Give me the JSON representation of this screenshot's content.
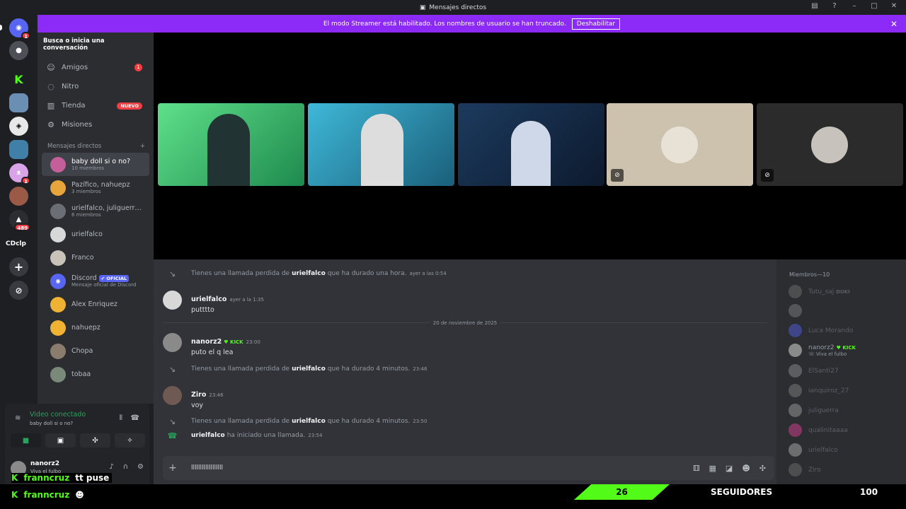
{
  "window": {
    "title": "Mensajes directos"
  },
  "banner": {
    "text": "El modo Streamer está habilitado. Los nombres de usuario se han truncado.",
    "button": "Deshabilitar"
  },
  "servers": {
    "badge_top": "1",
    "badge_cat": "1",
    "badge_489": "489",
    "text_server": "CDclp"
  },
  "sidebar": {
    "search": "Busca o inicia una conversación",
    "nav": [
      {
        "label": "Amigos",
        "badge": "1"
      },
      {
        "label": "Nitro"
      },
      {
        "label": "Tienda",
        "badge": "NUEVO"
      },
      {
        "label": "Misiones"
      }
    ],
    "dm_header": "Mensajes directos",
    "dms": [
      {
        "name": "baby doll si o no?",
        "sub": "10 miembros"
      },
      {
        "name": "Pazífico, nahuepz",
        "sub": "3 miembros"
      },
      {
        "name": "urielfalco, juliguerra, ...",
        "sub": "6 miembros"
      },
      {
        "name": "urielfalco"
      },
      {
        "name": "Franco"
      },
      {
        "name": "Discord",
        "tag": "✔ OFICIAL",
        "sub": "Mensaje oficial de Discord"
      },
      {
        "name": "Alex Enriquez"
      },
      {
        "name": "nahuepz"
      },
      {
        "name": "Chopa"
      },
      {
        "name": "tobaa"
      }
    ]
  },
  "voice": {
    "status": "Video conectado",
    "channel": "baby doll si o no?"
  },
  "user": {
    "name": "nanorz2",
    "status": "Viva el fulbo"
  },
  "chat": {
    "date_divider": "20 de noviembre de 2025",
    "sys1": {
      "pre": "Tienes una llamada perdida de",
      "user": "urielfalco",
      "post": "que ha durado una hora.",
      "ts": "ayer a las 0:54"
    },
    "m1": {
      "author": "urielfalco",
      "ts": "ayer a la 1:35",
      "text": "putttto"
    },
    "m2": {
      "author": "nanorz2",
      "badge": "KICK",
      "ts": "23:00",
      "text": "puto el q lea"
    },
    "sys2": {
      "pre": "Tienes una llamada perdida de",
      "user": "urielfalco",
      "post": "que ha durado 4 minutos.",
      "ts": "23:46"
    },
    "m3": {
      "author": "Ziro",
      "ts": "23:46",
      "text": "voy"
    },
    "sys3": {
      "pre": "Tienes una llamada perdida de",
      "user": "urielfalco",
      "post": "que ha durado 4 minutos.",
      "ts": "23:50"
    },
    "sys4": {
      "user": "urielfalco",
      "post": "ha iniciado una llamada.",
      "ts": "23:54"
    },
    "composer_value": "llllllllllllllllll"
  },
  "members": {
    "header": "Miembros—10",
    "list": [
      {
        "name": "Tutu_saj",
        "extra": "DUKI"
      },
      {
        "name": ""
      },
      {
        "name": "Luca Morando"
      },
      {
        "name": "nanorz2",
        "extra": "KICK",
        "status": "Viva el fulbo"
      },
      {
        "name": "ElSanti27"
      },
      {
        "name": "ianquiroz_27"
      },
      {
        "name": "juliguerra"
      },
      {
        "name": "qualinitaaaa"
      },
      {
        "name": "urielfalco"
      },
      {
        "name": "Ziro"
      }
    ]
  },
  "overlay": {
    "line1_user": "franncruz",
    "line1_text": "tt puse",
    "line2_user": "franncruz",
    "followers_count": "26",
    "followers_label": "SEGUIDORES",
    "followers_goal": "100"
  },
  "colors": {
    "accent": "#5865f2",
    "banner": "#8c2bf8",
    "kick_green": "#53fc18",
    "danger": "#f23f43",
    "online": "#23a55a"
  }
}
